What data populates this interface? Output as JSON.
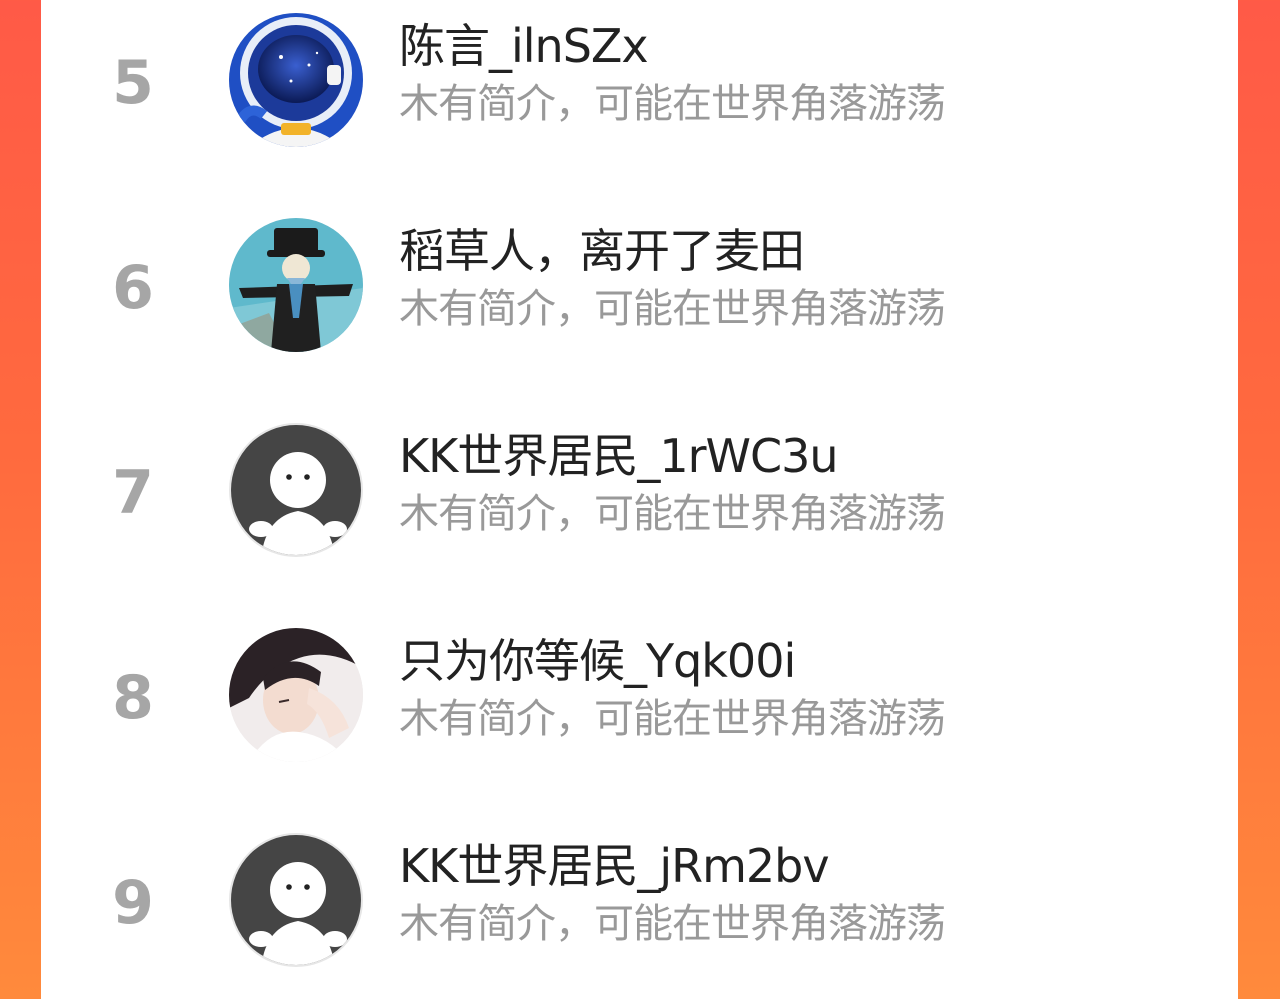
{
  "leaderboard": {
    "items": [
      {
        "rank": "5",
        "username": "陈言_ilnSZx",
        "bio": "木有简介，可能在世界角落游荡",
        "avatar_icon": "astronaut-avatar-icon"
      },
      {
        "rank": "6",
        "username": "稻草人，离开了麦田",
        "bio": "木有简介，可能在世界角落游荡",
        "avatar_icon": "scarecrow-avatar-icon"
      },
      {
        "rank": "7",
        "username": "KK世界居民_1rWC3u",
        "bio": "木有简介，可能在世界角落游荡",
        "avatar_icon": "default-user-avatar-icon"
      },
      {
        "rank": "8",
        "username": "只为你等候_Yqk00i",
        "bio": "木有简介，可能在世界角落游荡",
        "avatar_icon": "portrait-avatar-icon"
      },
      {
        "rank": "9",
        "username": "KK世界居民_jRm2bv",
        "bio": "木有简介，可能在世界角落游荡",
        "avatar_icon": "default-user-avatar-icon"
      }
    ]
  },
  "colors": {
    "background_gradient_start": "#ff5a47",
    "background_gradient_end": "#ff8a3c",
    "panel": "#ffffff",
    "rank_text": "#a6a6a6",
    "username_text": "#222222",
    "bio_text": "#999999"
  }
}
